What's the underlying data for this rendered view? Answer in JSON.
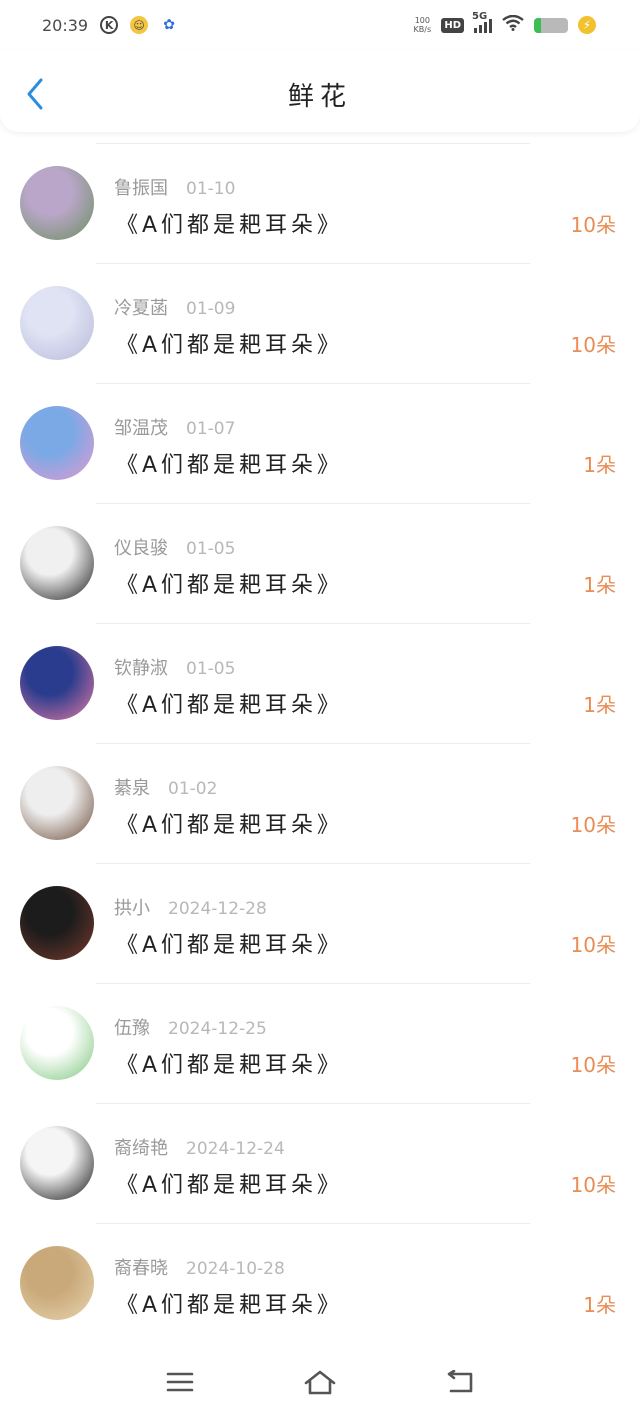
{
  "status_bar": {
    "time": "20:39",
    "net_speed_top": "100",
    "net_speed_bottom": "KB/s",
    "hd": "HD",
    "network": "5G"
  },
  "header": {
    "title": "鲜花"
  },
  "items": [
    {
      "name": "鲁振国",
      "date": "01-10",
      "book": "《A们都是耙耳朵》",
      "count": "10朵",
      "avatar_colors": [
        "#b9a6c8",
        "#6a8f5d"
      ]
    },
    {
      "name": "冷夏菡",
      "date": "01-09",
      "book": "《A们都是耙耳朵》",
      "count": "10朵",
      "avatar_colors": [
        "#dfe3f4",
        "#b7b9d8"
      ]
    },
    {
      "name": "邹温茂",
      "date": "01-07",
      "book": "《A们都是耙耳朵》",
      "count": "1朵",
      "avatar_colors": [
        "#7aa9e6",
        "#e59ad0"
      ]
    },
    {
      "name": "仪良骏",
      "date": "01-05",
      "book": "《A们都是耙耳朵》",
      "count": "1朵",
      "avatar_colors": [
        "#f0f0f0",
        "#1a1a1a"
      ]
    },
    {
      "name": "钦静淑",
      "date": "01-05",
      "book": "《A们都是耙耳朵》",
      "count": "1朵",
      "avatar_colors": [
        "#2a3c8e",
        "#e87aa2"
      ]
    },
    {
      "name": "綦泉",
      "date": "01-02",
      "book": "《A们都是耙耳朵》",
      "count": "10朵",
      "avatar_colors": [
        "#eeeeee",
        "#6b4a36"
      ]
    },
    {
      "name": "拱小",
      "date": "2024-12-28",
      "book": "《A们都是耙耳朵》",
      "count": "10朵",
      "avatar_colors": [
        "#1c1c1c",
        "#7a3a2c"
      ]
    },
    {
      "name": "伍豫",
      "date": "2024-12-25",
      "book": "《A们都是耙耳朵》",
      "count": "10朵",
      "avatar_colors": [
        "#ffffff",
        "#7cc57c"
      ]
    },
    {
      "name": "裔绮艳",
      "date": "2024-12-24",
      "book": "《A们都是耙耳朵》",
      "count": "10朵",
      "avatar_colors": [
        "#f5f5f5",
        "#111111"
      ]
    },
    {
      "name": "裔春晓",
      "date": "2024-10-28",
      "book": "《A们都是耙耳朵》",
      "count": "1朵",
      "avatar_colors": [
        "#c9a97a",
        "#e8d6b0"
      ]
    }
  ],
  "colors": {
    "accent": "#2a8ee0",
    "count": "#e98c55",
    "meta": "#9a9a9a"
  }
}
